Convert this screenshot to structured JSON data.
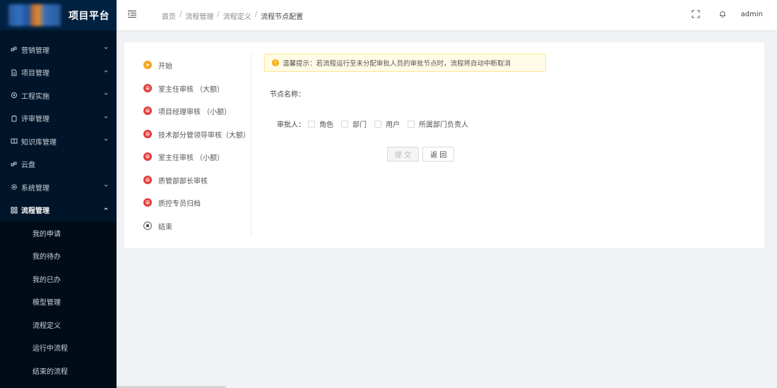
{
  "app": {
    "title": "项目平台"
  },
  "sidebar": {
    "items": [
      {
        "label": "营销管理",
        "icon": "cluster-icon"
      },
      {
        "label": "项目管理",
        "icon": "file-icon"
      },
      {
        "label": "工程实施",
        "icon": "gear-icon"
      },
      {
        "label": "评审管理",
        "icon": "clipboard-icon"
      },
      {
        "label": "知识库管理",
        "icon": "book-icon"
      },
      {
        "label": "云盘",
        "icon": "cluster-icon"
      },
      {
        "label": "系统管理",
        "icon": "settings-icon"
      },
      {
        "label": "流程管理",
        "icon": "flow-icon"
      }
    ],
    "sub_items": [
      {
        "label": "我的申请"
      },
      {
        "label": "我的待办"
      },
      {
        "label": "我的已办"
      },
      {
        "label": "模型管理"
      },
      {
        "label": "流程定义"
      },
      {
        "label": "运行中流程"
      },
      {
        "label": "结束的流程"
      }
    ]
  },
  "header": {
    "breadcrumb": [
      "首页",
      "流程管理",
      "流程定义",
      "流程节点配置"
    ],
    "breadcrumb_sep": "/",
    "username": "admin"
  },
  "steps": [
    {
      "label": "开始",
      "type": "start"
    },
    {
      "label": "室主任审核 （大额）",
      "type": "approve"
    },
    {
      "label": "项目经理审核 （小额）",
      "type": "approve"
    },
    {
      "label": "技术部分管领导审核（大额）",
      "type": "approve"
    },
    {
      "label": "室主任审核 （小额）",
      "type": "approve"
    },
    {
      "label": "质管部部长审核",
      "type": "approve"
    },
    {
      "label": "质控专员归档",
      "type": "approve"
    },
    {
      "label": "结束",
      "type": "end"
    }
  ],
  "step_badge": "审",
  "alert": {
    "text": "温馨提示：若流程运行至未分配审批人员的审批节点时，流程将自动中断取消"
  },
  "form": {
    "node_name_label": "节点名称：",
    "approver_label": "审批人：",
    "options": [
      "角色",
      "部门",
      "用户",
      "所属部门负责人"
    ],
    "submit_label": "提 交",
    "back_label": "返 回"
  },
  "colors": {
    "sidebar_bg": "#001529",
    "sidebar_sub_bg": "#000c17",
    "start_icon": "#f5a623",
    "approve_icon": "#e03c3c",
    "alert_bg": "#fffbe6",
    "alert_border": "#ffe58f",
    "alert_icon": "#faad14"
  }
}
